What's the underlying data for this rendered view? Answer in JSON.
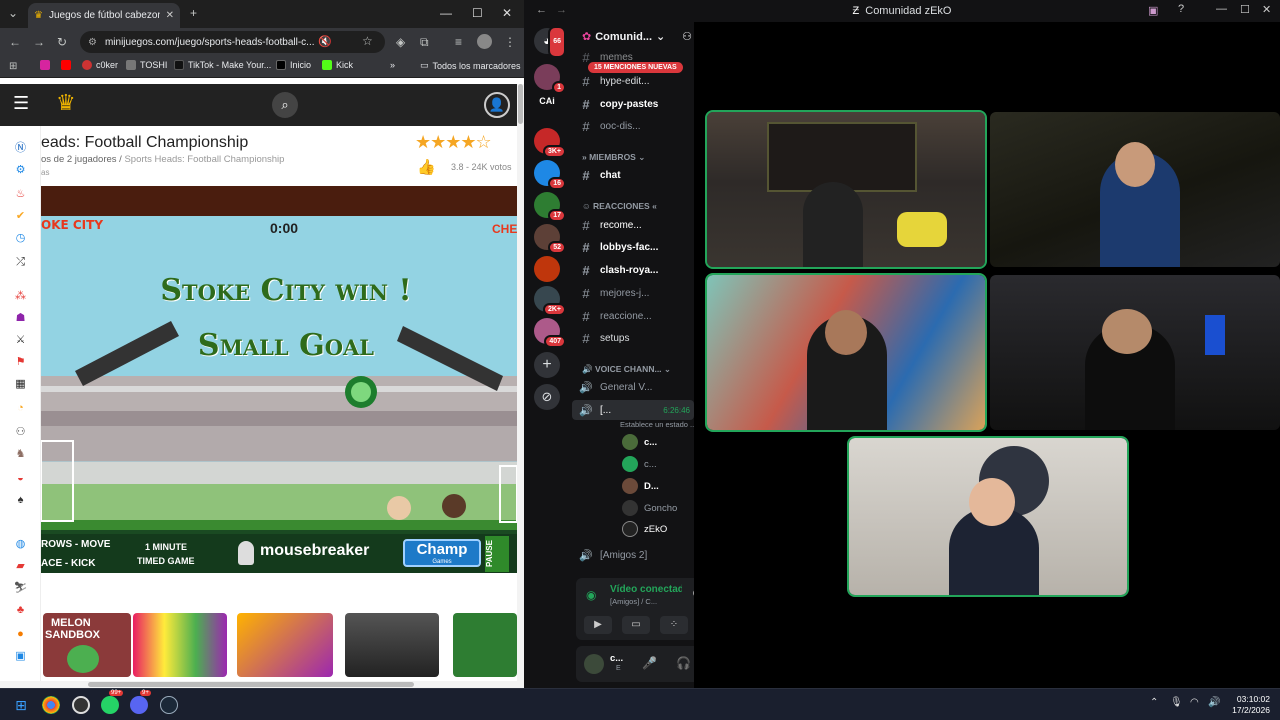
{
  "chrome": {
    "tab_title": "Juegos de fútbol cabezones",
    "url": "minijuegos.com/juego/sports-heads-football-c...",
    "bookmarks": [
      "c0ker",
      "TOSHI",
      "TikTok - Make Your...",
      "Inicio",
      "Kick"
    ],
    "bookmarks_folder": "Todos los marcadores"
  },
  "site": {
    "game_title": "eads: Football Championship",
    "breadcrumb_prefix": "os de 2 jugadores",
    "breadcrumb_sep": "/",
    "breadcrumb_current": "Sports Heads: Football Championship",
    "tags_cut": "as",
    "rating_text": "3.8 - 24K votos",
    "rating": 3.8,
    "stars": "★★★★☆"
  },
  "game": {
    "team_left": "oke City",
    "team_right": "Che",
    "timer": "0:00",
    "win_line1": "Stoke City win !",
    "win_line2": "Small Goal",
    "controls_line1": "rows - Move",
    "controls_line2": "ace - Kick",
    "mode_line1": "1 MINUTE",
    "mode_line2": "TIMED GAME",
    "sponsor": "mousebreaker",
    "logo": "Champ",
    "logo_sub": "Games",
    "pause": "PAUSE"
  },
  "thumbs": {
    "melon_line1": "MELON",
    "melon_line2": "SANDBOX"
  },
  "discord": {
    "window_title": "Comunidad zEkO",
    "server_name": "Comunid...",
    "mentions_pill": "15 MENCIONES NUEVAS",
    "channels": [
      {
        "name": "memes"
      },
      {
        "name": "hype-edit..."
      },
      {
        "name": "copy-pastes"
      },
      {
        "name": "ooc-dis..."
      }
    ],
    "cat_members": "MIEMBROS",
    "members_channels": [
      {
        "name": "chat"
      }
    ],
    "cat_reactions": "REACCIONES",
    "reaction_channels": [
      {
        "name": "recome..."
      },
      {
        "name": "lobbys-fac..."
      },
      {
        "name": "clash-roya..."
      },
      {
        "name": "mejores-j..."
      },
      {
        "name": "reaccione..."
      },
      {
        "name": "setups"
      }
    ],
    "cat_voice": "VOICE CHANN...",
    "voice_general": "General V...",
    "voice_active": "[...",
    "voice_timer": "6:26:46",
    "voice_status": "Establece un estado ...",
    "voice_users": [
      "c...",
      "c...",
      "D...",
      "Goncho",
      "zEkO"
    ],
    "voice_amigos": "[Amigos 2]",
    "panel_status": "Vídeo conectad",
    "panel_channel": "[Amigos] / C...",
    "user_name": "c...",
    "user_status": "E",
    "server_badges": [
      "66",
      "1",
      "",
      "3K+",
      "16",
      "17",
      "52",
      "",
      "2K+",
      "407"
    ],
    "cai_label": "CAi"
  },
  "taskbar": {
    "time": "03:10:02",
    "date": "17/2/2026",
    "badge_whatsapp": "99+",
    "badge_discord": "9+"
  },
  "colors": {
    "discord_bg": "#121214",
    "speaking": "#23a55a",
    "mention_red": "#da373c",
    "chrome_dark": "#35363a"
  }
}
